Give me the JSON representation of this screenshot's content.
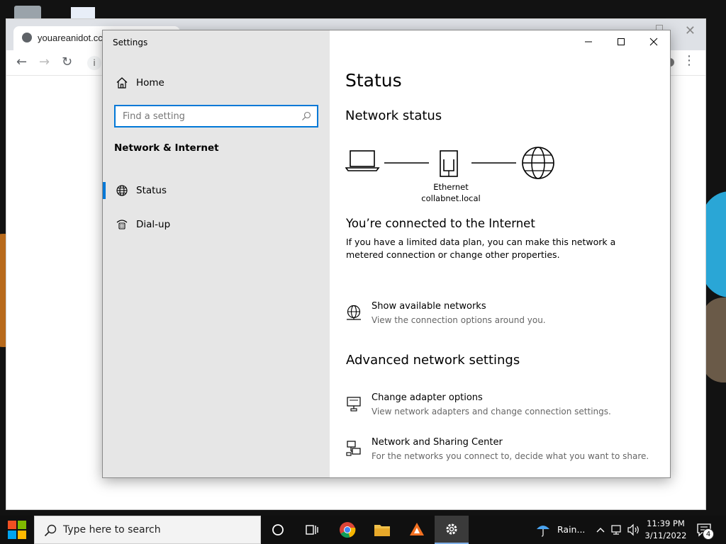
{
  "browser": {
    "tab_title": "youareanidot.cc",
    "close_glyph": "✕",
    "back_glyph": "←",
    "forward_glyph": "→",
    "reload_glyph": "↻",
    "info_glyph": "i",
    "menu_glyph": "⋮"
  },
  "settings": {
    "window_title": "Settings",
    "sidebar": {
      "home_label": "Home",
      "search_placeholder": "Find a setting",
      "section_heading": "Network & Internet",
      "items": [
        {
          "label": "Status",
          "icon": "globe-icon",
          "active": true
        },
        {
          "label": "Dial-up",
          "icon": "dialup-icon",
          "active": false
        }
      ]
    },
    "content": {
      "page_title": "Status",
      "network_status_heading": "Network status",
      "diagram": {
        "adapter_name": "Ethernet",
        "network_name": "collabnet.local"
      },
      "connected_heading": "You’re connected to the Internet",
      "connected_body": "If you have a limited data plan, you can make this network a metered connection or change other properties.",
      "show_networks": {
        "title": "Show available networks",
        "desc": "View the connection options around you."
      },
      "advanced_heading": "Advanced network settings",
      "links": [
        {
          "title": "Change adapter options",
          "desc": "View network adapters and change connection settings.",
          "icon": "monitor-network-icon"
        },
        {
          "title": "Network and Sharing Center",
          "desc": "For the networks you connect to, decide what you want to share.",
          "icon": "sharing-center-icon"
        }
      ]
    }
  },
  "taskbar": {
    "search_placeholder": "Type here to search",
    "weather_text": "Rain...",
    "time": "11:39 PM",
    "date": "3/11/2022",
    "notification_count": "4",
    "colors": {
      "accent": "#0078d7",
      "taskbar_bg": "#101010"
    }
  }
}
